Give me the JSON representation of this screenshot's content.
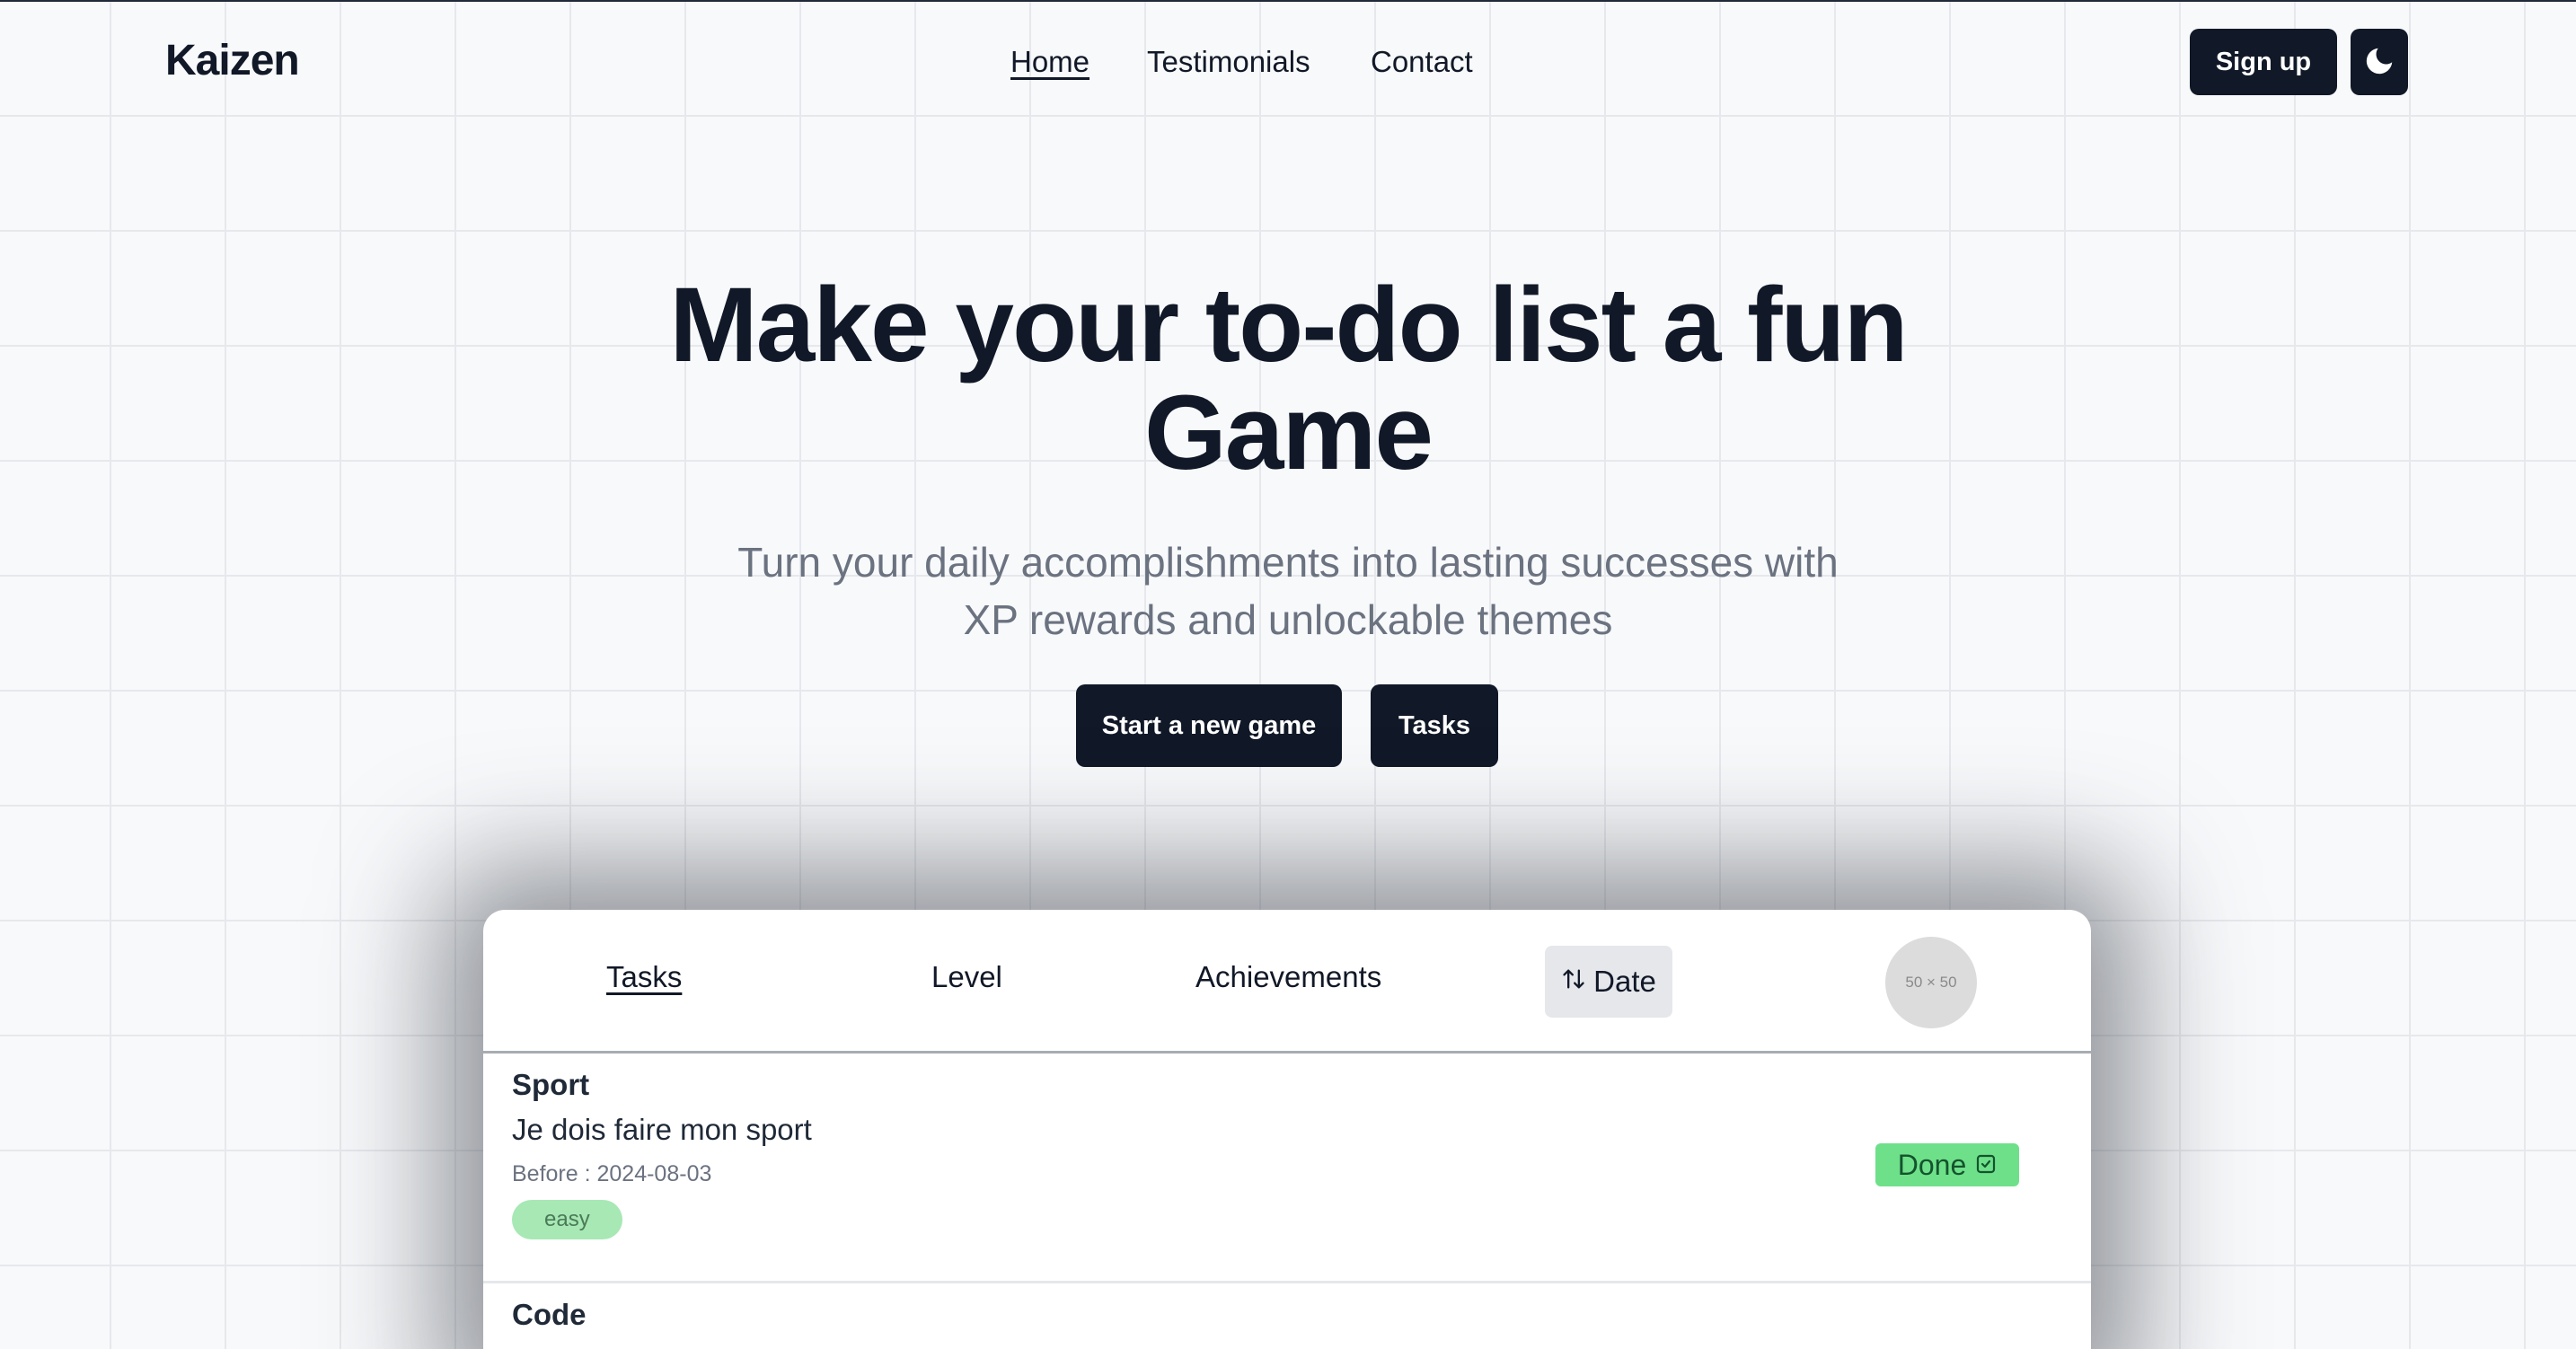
{
  "brand": {
    "name": "Kaizen"
  },
  "nav": {
    "links": [
      {
        "label": "Home",
        "active": true
      },
      {
        "label": "Testimonials",
        "active": false
      },
      {
        "label": "Contact",
        "active": false
      }
    ],
    "signup_label": "Sign up",
    "theme_icon": "moon-icon"
  },
  "hero": {
    "title_line1": "Make your to-do list a fun",
    "title_line2": "Game",
    "subtitle_line1": "Turn your daily accomplishments into lasting successes with",
    "subtitle_line2": "XP rewards and unlockable themes",
    "primary_cta": "Start a new game",
    "secondary_cta": "Tasks"
  },
  "preview": {
    "tabs": [
      {
        "label": "Tasks",
        "active": true
      },
      {
        "label": "Level",
        "active": false
      },
      {
        "label": "Achievements",
        "active": false
      }
    ],
    "sort": {
      "label": "Date",
      "icon": "sort-arrows-icon"
    },
    "avatar_placeholder": "50 × 50",
    "tasks": [
      {
        "category": "Sport",
        "description": "Je dois faire mon sport",
        "due": "Before : 2024-08-03",
        "difficulty": "easy",
        "status_label": "Done"
      },
      {
        "category": "Code"
      }
    ]
  },
  "colors": {
    "primary": "#111827",
    "muted_text": "#6b7280",
    "done_badge": "#6ee08a",
    "easy_badge": "#a7e8b5",
    "grid_line": "#e6e8ec"
  }
}
